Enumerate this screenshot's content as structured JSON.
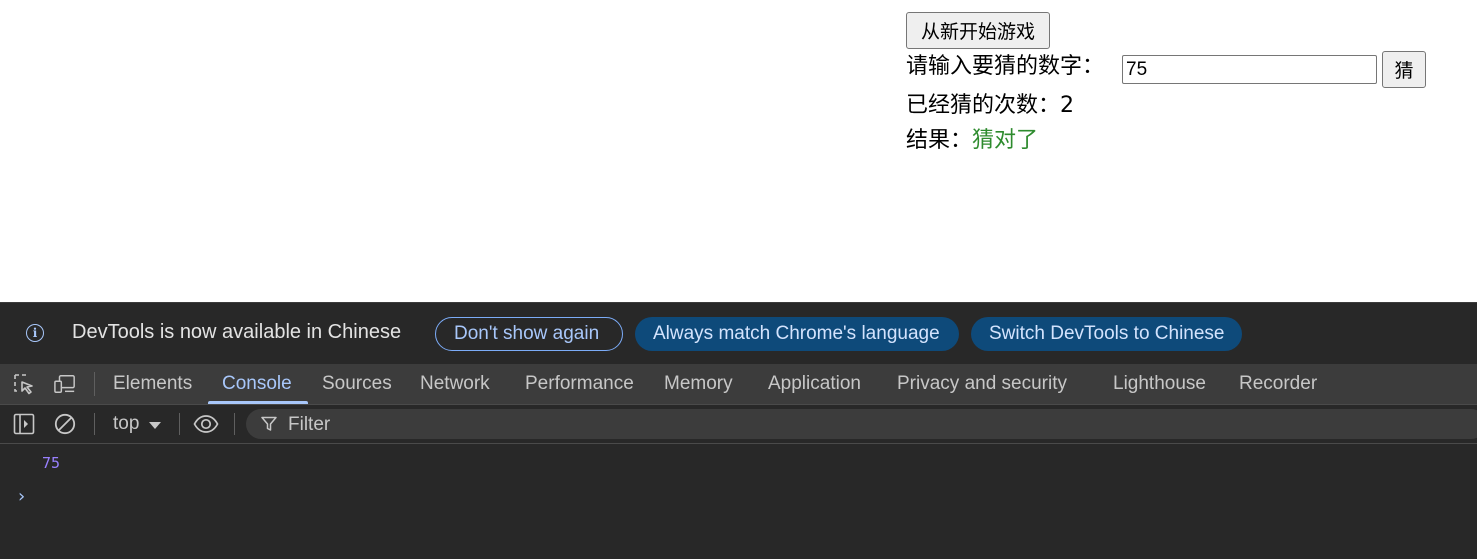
{
  "game": {
    "restart_label": "从新开始游戏",
    "prompt_label": "请输入要猜的数字：",
    "input_value": "75",
    "guess_label": "猜",
    "count_label": "已经猜的次数：",
    "count_value": "2",
    "result_label": "结果：",
    "result_value": "猜对了",
    "result_color": "#2e8b2e"
  },
  "devtools": {
    "infobar": {
      "message": "DevTools is now available in Chinese",
      "dont_show": "Don't show again",
      "always_match": "Always match Chrome's language",
      "switch": "Switch DevTools to Chinese"
    },
    "tabs": [
      {
        "label": "Elements"
      },
      {
        "label": "Console",
        "active": true
      },
      {
        "label": "Sources"
      },
      {
        "label": "Network"
      },
      {
        "label": "Performance"
      },
      {
        "label": "Memory"
      },
      {
        "label": "Application"
      },
      {
        "label": "Privacy and security"
      },
      {
        "label": "Lighthouse"
      },
      {
        "label": "Recorder"
      }
    ],
    "console_toolbar": {
      "context": "top",
      "filter_placeholder": "Filter"
    },
    "console_log": [
      "75"
    ],
    "accent_color": "#a8c7fa"
  }
}
